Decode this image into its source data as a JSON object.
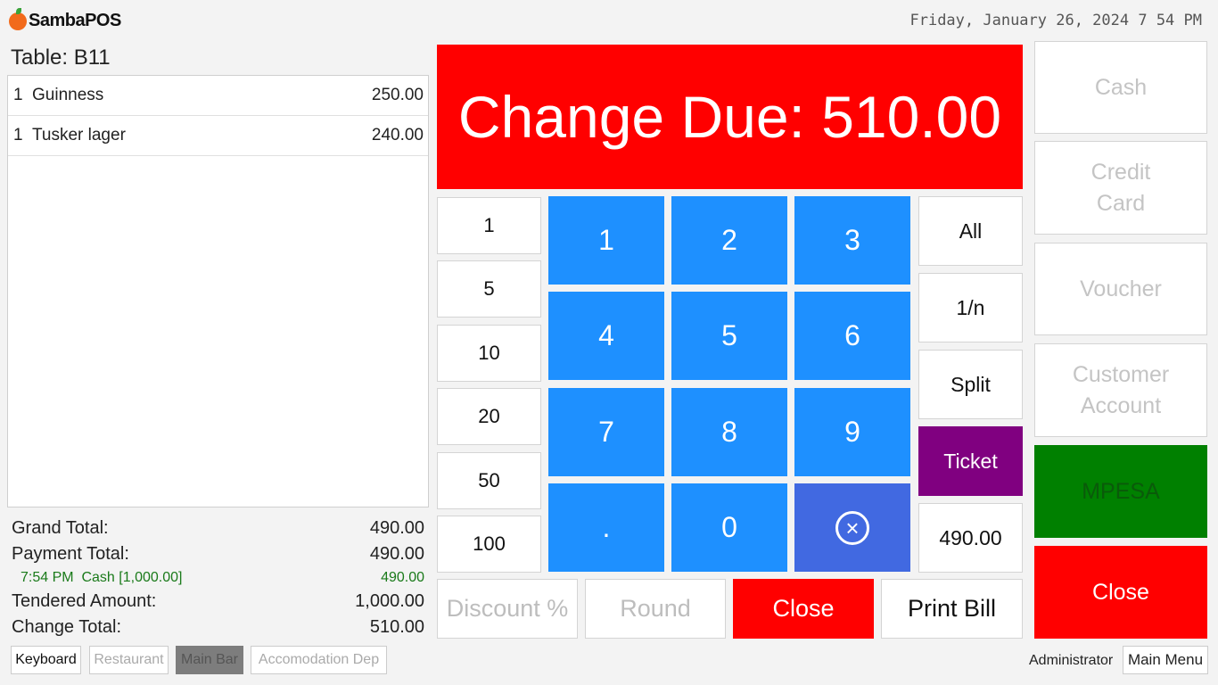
{
  "app": {
    "logo_text": "SambaPOS",
    "datetime": "Friday, January 26, 2024 7 54 PM"
  },
  "ticket": {
    "table_label": "Table: B11",
    "items": [
      {
        "qty": "1",
        "name": "Guinness",
        "price": "250.00"
      },
      {
        "qty": "1",
        "name": "Tusker lager",
        "price": "240.00"
      }
    ]
  },
  "totals": {
    "grand_total_label": "Grand Total:",
    "grand_total": "490.00",
    "payment_total_label": "Payment Total:",
    "payment_total": "490.00",
    "payment_line_label": "7:54 PM  Cash [1,000.00]",
    "payment_line_amount": "490.00",
    "tendered_label": "Tendered Amount:",
    "tendered": "1,000.00",
    "change_label": "Change Total:",
    "change": "510.00"
  },
  "change_due": "Change Due: 510.00",
  "quick_amounts": [
    "1",
    "5",
    "10",
    "20",
    "50",
    "100"
  ],
  "keypad": [
    "1",
    "2",
    "3",
    "4",
    "5",
    "6",
    "7",
    "8",
    "9",
    ".",
    "0"
  ],
  "split_buttons": {
    "all": "All",
    "one_n": "1/n",
    "split": "Split",
    "ticket": "Ticket",
    "amount": "490.00"
  },
  "actions": {
    "discount": "Discount %",
    "round": "Round",
    "close": "Close",
    "print_bill": "Print Bill"
  },
  "payment_types": {
    "cash": "Cash",
    "credit_card_1": "Credit",
    "credit_card_2": "Card",
    "voucher": "Voucher",
    "customer_account_1": "Customer",
    "customer_account_2": "Account",
    "mpesa": "MPESA",
    "close": "Close"
  },
  "footer": {
    "tabs": [
      "Keyboard",
      "Restaurant",
      "Main Bar",
      "Accomodation Dep"
    ],
    "user": "Administrator",
    "main_menu": "Main Menu"
  },
  "colors": {
    "change_due_bg": "#ff0000",
    "keypad": "#1e90ff",
    "backspace": "#4169e1",
    "ticket": "#800080",
    "mpesa": "#008000",
    "close": "#ff0000"
  }
}
